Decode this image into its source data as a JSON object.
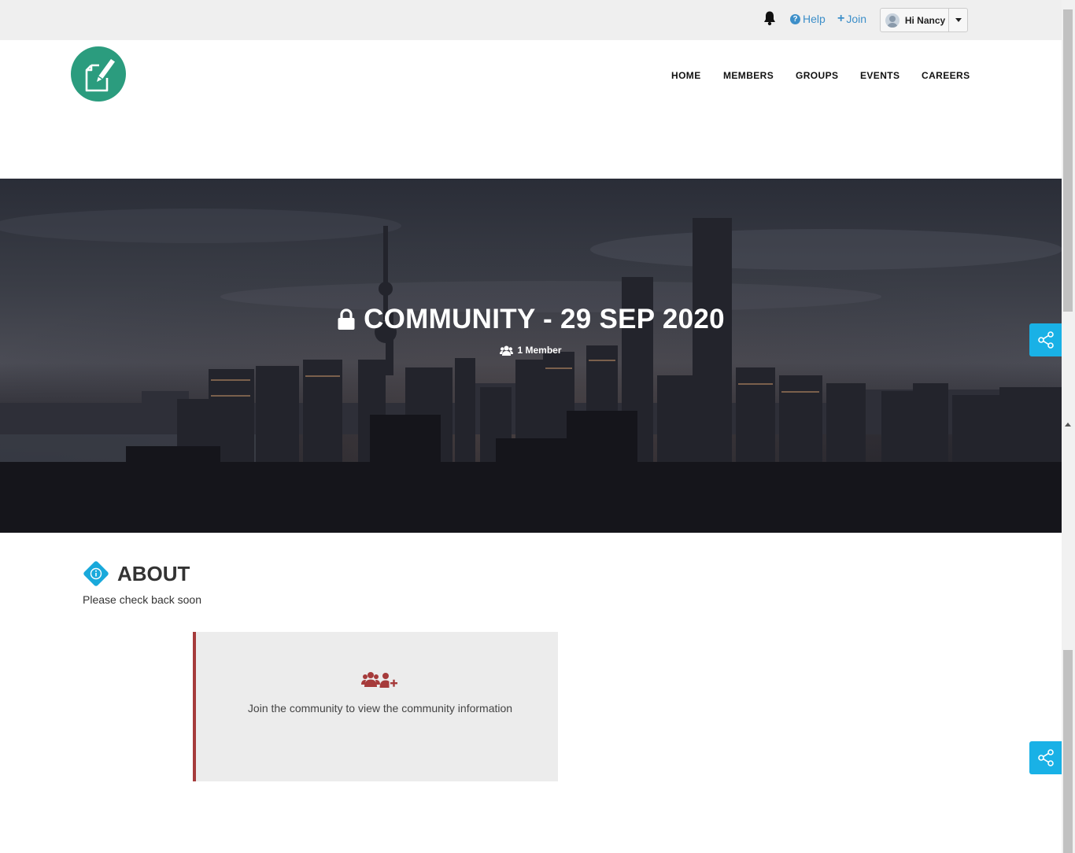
{
  "topbar": {
    "help_label": "Help",
    "join_label": "Join",
    "user_greeting": "Hi Nancy"
  },
  "nav": {
    "items": [
      {
        "label": "HOME"
      },
      {
        "label": "MEMBERS"
      },
      {
        "label": "GROUPS"
      },
      {
        "label": "EVENTS"
      },
      {
        "label": "CAREERS"
      }
    ]
  },
  "hero": {
    "title": "COMMUNITY - 29 SEP 2020",
    "members_label": "1 Member"
  },
  "about": {
    "heading": "ABOUT",
    "text": "Please check back soon"
  },
  "join_card": {
    "message": "Join the community to view the community information"
  },
  "colors": {
    "brand_green": "#2b9c7e",
    "link_blue": "#3d8fc9",
    "share_blue": "#19b1e6",
    "card_accent": "#a63b3b"
  },
  "icons": [
    "bell-icon",
    "help-icon",
    "plus-icon",
    "avatar",
    "caret-down-icon",
    "edit-document-icon",
    "lock-icon",
    "users-icon",
    "share-icon",
    "info-icon",
    "join-users-icon"
  ]
}
